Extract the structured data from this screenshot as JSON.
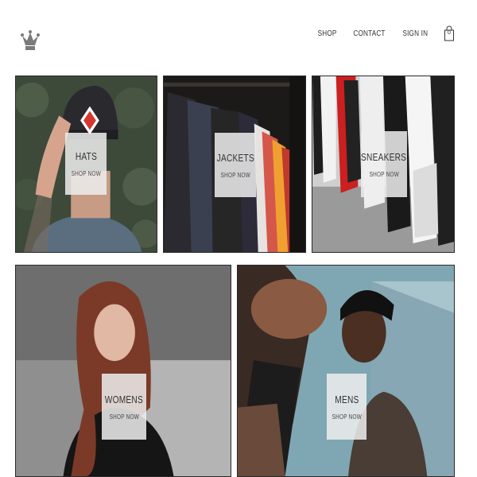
{
  "header": {
    "logo_icon": "crown-icon",
    "nav": [
      {
        "label": "SHOP"
      },
      {
        "label": "CONTACT"
      },
      {
        "label": "SIGN IN"
      }
    ],
    "cart": {
      "icon": "shopping-bag-icon",
      "count": "0"
    }
  },
  "categories": [
    {
      "name": "HATS",
      "cta": "SHOP NOW"
    },
    {
      "name": "JACKETS",
      "cta": "SHOP NOW"
    },
    {
      "name": "SNEAKERS",
      "cta": "SHOP NOW"
    },
    {
      "name": "WOMENS",
      "cta": "SHOP NOW"
    },
    {
      "name": "MENS",
      "cta": "SHOP NOW"
    }
  ],
  "colors": {
    "background": "#ffffff",
    "label_box": "#eeeeee",
    "text": "#333333"
  }
}
